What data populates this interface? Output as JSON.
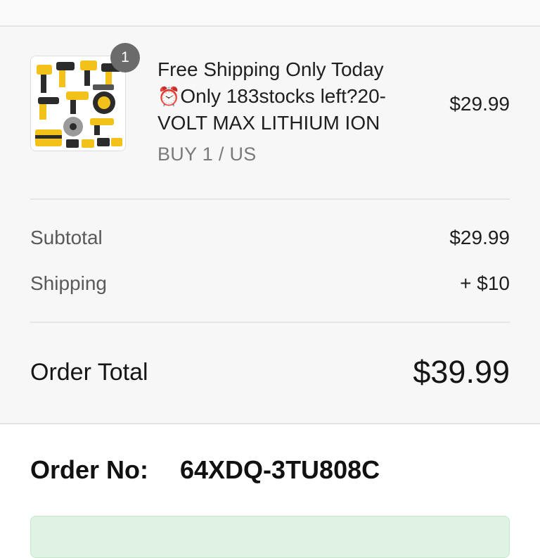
{
  "cart_item": {
    "quantity_badge": "1",
    "title_line1": "Free Shipping Only Today",
    "title_line2": "Only 183stocks left?20-",
    "title_line3": "VOLT MAX LITHIUM ION",
    "clock_icon": "⏰",
    "variant": "BUY 1 / US",
    "price": "$29.99",
    "image_icon": "power-tool-kit-image"
  },
  "summary": {
    "subtotal_label": "Subtotal",
    "subtotal_value": "$29.99",
    "shipping_label": "Shipping",
    "shipping_value": "+ $10",
    "total_label": "Order Total",
    "total_value": "$39.99"
  },
  "order": {
    "label": "Order No:",
    "number": "64XDQ-3TU808C"
  },
  "colors": {
    "summary_bg": "#f7f7f7",
    "badge_bg": "#6b6b6b",
    "notice_bg": "#dff2e3",
    "tool_yellow": "#f2c21b"
  }
}
